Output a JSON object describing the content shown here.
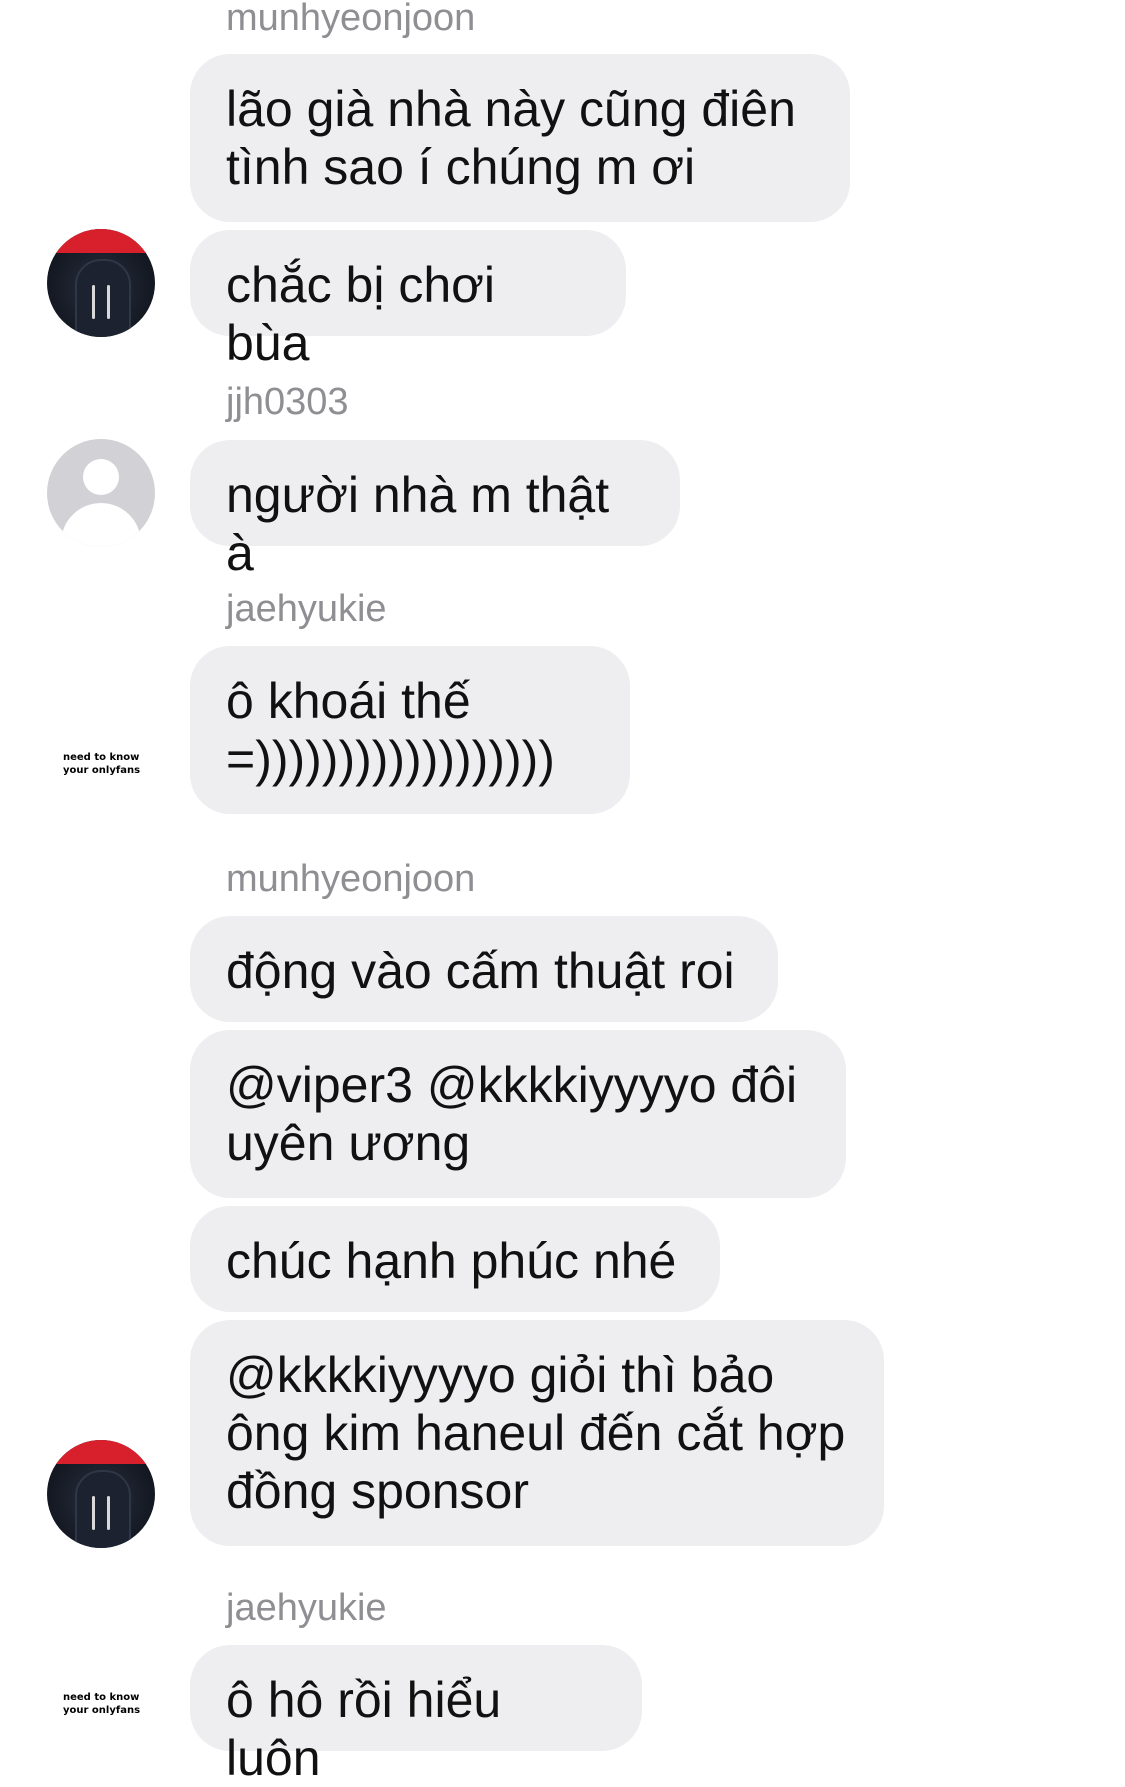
{
  "messages": [
    {
      "sender": "munhyeonjoon"
    },
    {
      "text": "lão già nhà này cũng điên tình sao í chúng m ơi"
    },
    {
      "text": "chắc bị chơi bùa"
    },
    {
      "sender": "jjh0303"
    },
    {
      "text": "người nhà m thật à"
    },
    {
      "sender": "jaehyukie"
    },
    {
      "text": "ô khoái thế =))))))))))))))))))"
    },
    {
      "sender": "munhyeonjoon"
    },
    {
      "text": "động vào cấm thuật roi"
    },
    {
      "text": "@viper3 @kkkkiyyyyo đôi uyên ương"
    },
    {
      "text": "chúc hạnh phúc nhé"
    },
    {
      "text": "@kkkkiyyyyo giỏi thì bảo ông kim haneul đến cắt hợp đồng sponsor"
    },
    {
      "sender": "jaehyukie"
    },
    {
      "text": "ô hô rồi hiểu luôn"
    }
  ],
  "avatars": {
    "jaehyukie": {
      "line1": "need to know",
      "line2": "your onlyfans"
    }
  },
  "colors": {
    "bubble": "#eeeef0",
    "sender": "#8e8e93",
    "text": "#111111"
  }
}
